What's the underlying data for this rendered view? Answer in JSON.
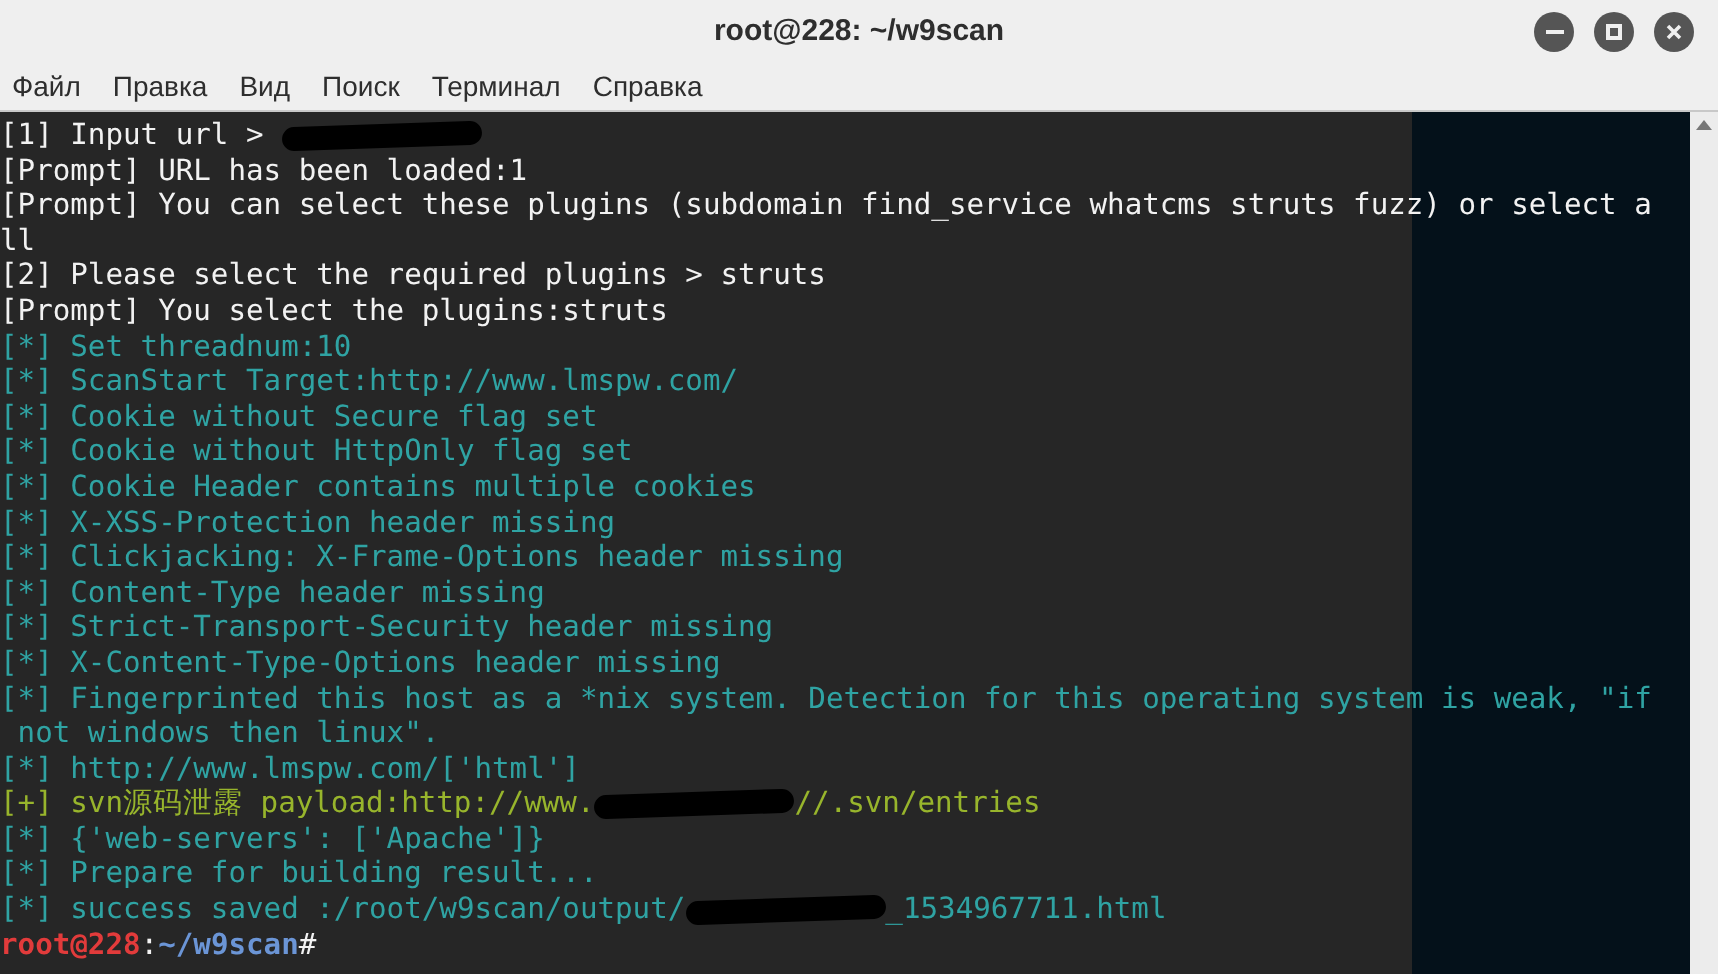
{
  "window": {
    "title": "root@228: ~/w9scan"
  },
  "menu": [
    "Файл",
    "Правка",
    "Вид",
    "Поиск",
    "Терминал",
    "Справка"
  ],
  "terminal": {
    "lines": [
      {
        "segments": [
          {
            "kind": "plain",
            "text": "[1] Input url > "
          },
          {
            "kind": "redacted"
          }
        ]
      },
      {
        "segments": [
          {
            "kind": "plain",
            "text": "[Prompt] URL has been loaded:1"
          }
        ]
      },
      {
        "segments": [
          {
            "kind": "plain",
            "text": "[Prompt] You can select these plugins (subdomain find_service whatcms struts fuzz) or select a"
          }
        ]
      },
      {
        "segments": [
          {
            "kind": "plain",
            "text": "ll"
          }
        ]
      },
      {
        "segments": [
          {
            "kind": "plain",
            "text": "[2] Please select the required plugins > struts"
          }
        ]
      },
      {
        "segments": [
          {
            "kind": "plain",
            "text": "[Prompt] You select the plugins:struts"
          }
        ]
      },
      {
        "segments": [
          {
            "kind": "info",
            "text": "[*] Set threadnum:10"
          }
        ]
      },
      {
        "segments": [
          {
            "kind": "info",
            "text": "[*] ScanStart Target:http://www.lmspw.com/"
          }
        ]
      },
      {
        "segments": [
          {
            "kind": "info",
            "text": "[*] Cookie without Secure flag set"
          }
        ]
      },
      {
        "segments": [
          {
            "kind": "info",
            "text": "[*] Cookie without HttpOnly flag set"
          }
        ]
      },
      {
        "segments": [
          {
            "kind": "info",
            "text": "[*] Cookie Header contains multiple cookies"
          }
        ]
      },
      {
        "segments": [
          {
            "kind": "info",
            "text": "[*] X-XSS-Protection header missing"
          }
        ]
      },
      {
        "segments": [
          {
            "kind": "info",
            "text": "[*] Clickjacking: X-Frame-Options header missing"
          }
        ]
      },
      {
        "segments": [
          {
            "kind": "info",
            "text": "[*] Content-Type header missing"
          }
        ]
      },
      {
        "segments": [
          {
            "kind": "info",
            "text": "[*] Strict-Transport-Security header missing"
          }
        ]
      },
      {
        "segments": [
          {
            "kind": "info",
            "text": "[*] X-Content-Type-Options header missing"
          }
        ]
      },
      {
        "segments": [
          {
            "kind": "info",
            "text": "[*] Fingerprinted this host as a *nix system. Detection for this operating system is weak, \"if"
          }
        ]
      },
      {
        "segments": [
          {
            "kind": "info",
            "text": " not windows then linux\"."
          }
        ]
      },
      {
        "segments": [
          {
            "kind": "info",
            "text": "[*] http://www.lmspw.com/['html']"
          }
        ]
      },
      {
        "segments": [
          {
            "kind": "found",
            "text": "[+] svn源码泄露 payload:http://www."
          },
          {
            "kind": "redacted"
          },
          {
            "kind": "found",
            "text": "//.svn/entries"
          }
        ]
      },
      {
        "segments": [
          {
            "kind": "info",
            "text": "[*] {'web-servers': ['Apache']}"
          }
        ]
      },
      {
        "segments": [
          {
            "kind": "info",
            "text": "[*] Prepare for building result..."
          }
        ]
      },
      {
        "segments": [
          {
            "kind": "info",
            "text": "[*] success saved :/root/w9scan/output/"
          },
          {
            "kind": "redacted"
          },
          {
            "kind": "info",
            "text": "_1534967711.html"
          }
        ]
      },
      {
        "segments": [
          {
            "kind": "user",
            "text": "root@228"
          },
          {
            "kind": "plain",
            "text": ":"
          },
          {
            "kind": "path",
            "text": "~/w9scan"
          },
          {
            "kind": "plain",
            "text": "#"
          }
        ]
      }
    ]
  }
}
